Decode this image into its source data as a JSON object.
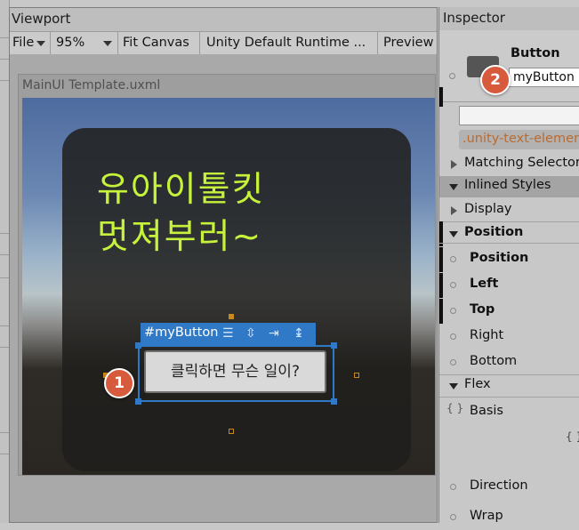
{
  "viewport": {
    "title": "Viewport",
    "toolbar": {
      "file": "File",
      "zoom": "95%",
      "fit_canvas": "Fit Canvas",
      "theme": "Unity Default Runtime ...",
      "preview": "Preview"
    },
    "template_name": "MainUI Template.uxml",
    "headline_line1": "유아이툴킷",
    "headline_line2": "멋져부러~",
    "selection_label": "#myButton",
    "button_text": "클릭하면 무슨 일이?"
  },
  "inspector": {
    "title": "Inspector",
    "element_type": "Button",
    "element_name": "myButton",
    "class_name": ".unity-text-element",
    "rows": {
      "matching_selectors": "Matching Selectors",
      "inlined_styles": "Inlined Styles",
      "display": "Display",
      "position_section": "Position",
      "position": "Position",
      "left": "Left",
      "top": "Top",
      "right": "Right",
      "bottom": "Bottom",
      "flex": "Flex",
      "basis_icon": "{ }",
      "basis": "Basis",
      "basis_value_icon": "{ }",
      "direction": "Direction",
      "wrap": "Wrap"
    }
  },
  "callouts": {
    "one": "1",
    "two": "2"
  },
  "colors": {
    "selection_blue": "#2f79c7",
    "headline_green": "#c6f23c",
    "callout_red": "#d85a3c",
    "handle_orange": "#c98a1c"
  }
}
